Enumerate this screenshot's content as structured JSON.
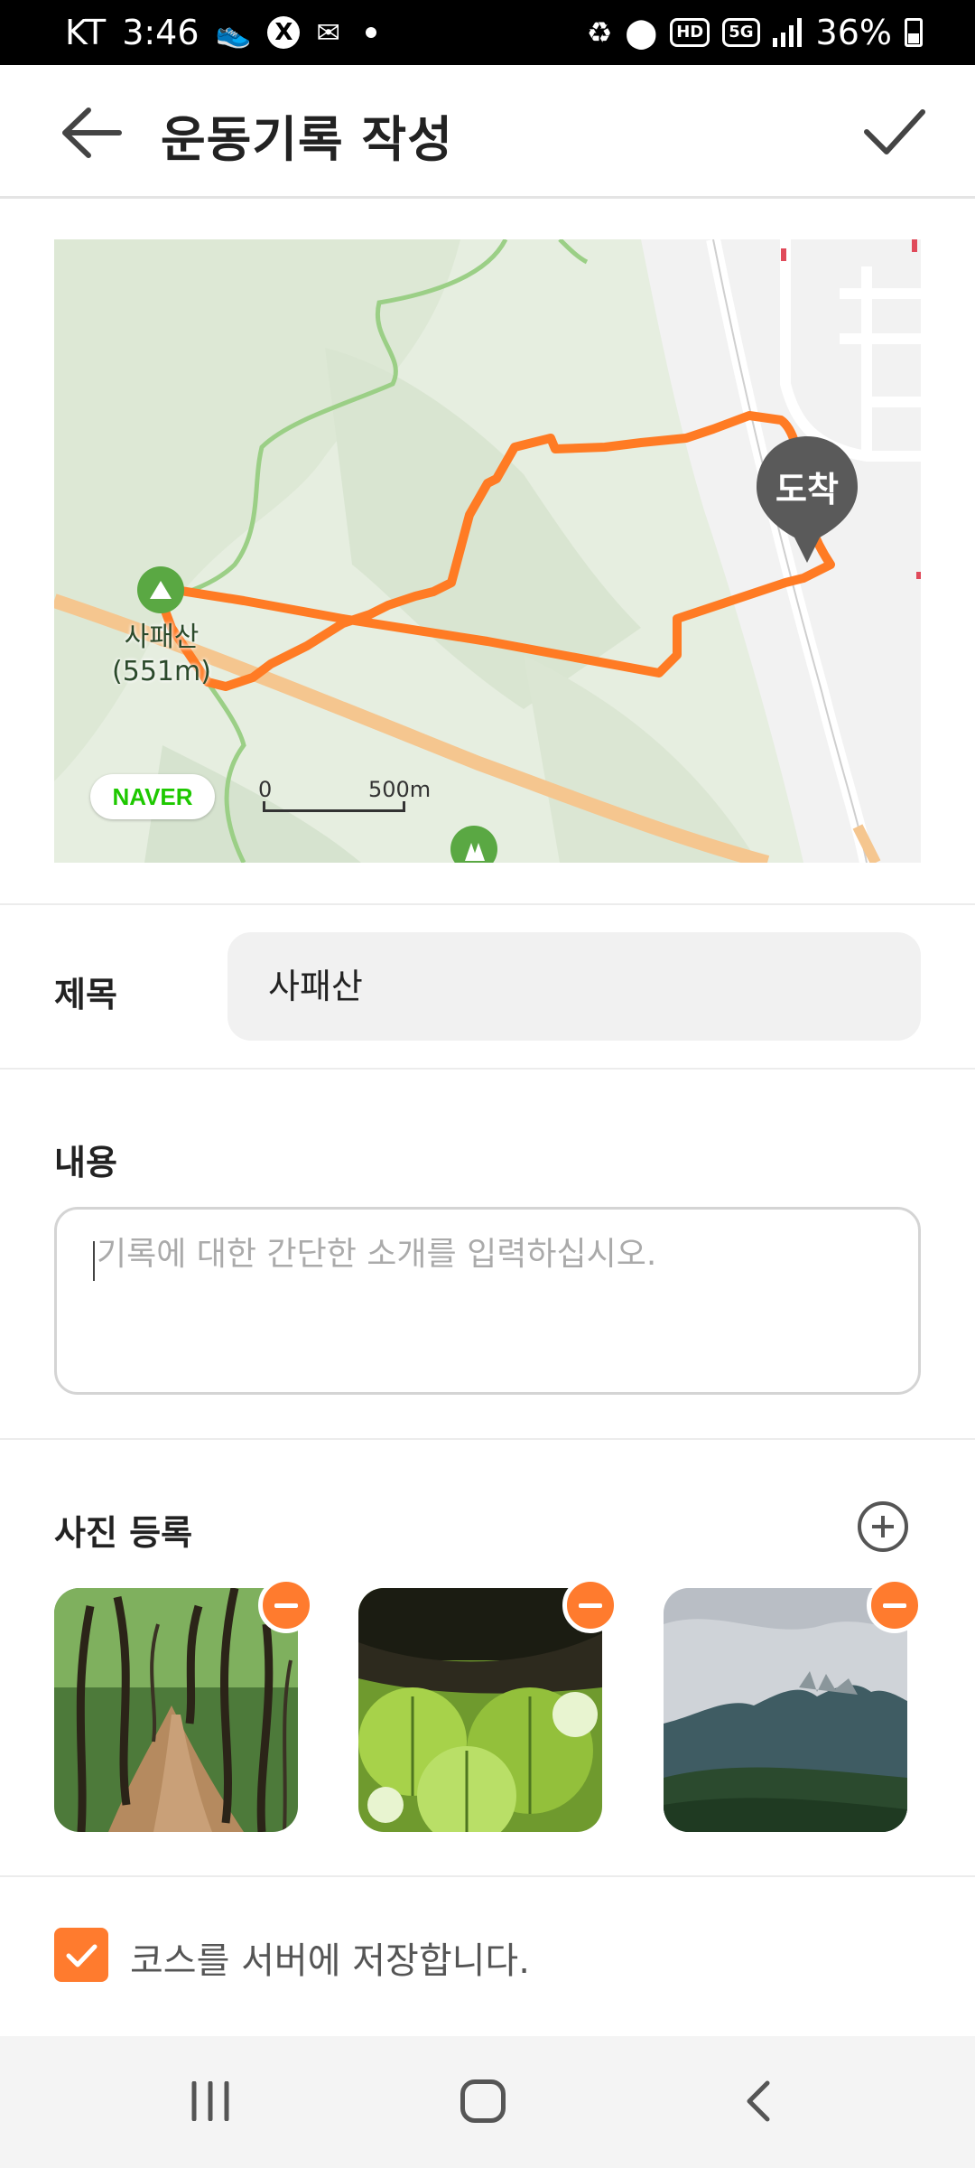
{
  "status_bar": {
    "carrier": "KT",
    "time": "3:46",
    "network": "5G",
    "hd": "HD",
    "battery": "36%"
  },
  "header": {
    "title": "운동기록 작성"
  },
  "map": {
    "peak_name": "사패산",
    "peak_elevation": "(551m)",
    "arrival_marker": "도착",
    "provider_logo": "NAVER",
    "scale_start": "0",
    "scale_label": "500m",
    "route_color": "#ff7b24"
  },
  "form": {
    "title_label": "제목",
    "title_value": "사패산",
    "content_label": "내용",
    "content_placeholder": "기록에 대한 간단한 소개를 입력하십시오.",
    "photo_label": "사진 등록",
    "save_course_label": "코스를 서버에 저장합니다.",
    "save_course_checked": true
  },
  "photos": [
    {
      "description": "forest-trail-photo"
    },
    {
      "description": "leaves-backlit-photo"
    },
    {
      "description": "mountain-ridge-photo"
    }
  ],
  "colors": {
    "accent": "#ff7b2e",
    "route": "#ff7b24"
  }
}
